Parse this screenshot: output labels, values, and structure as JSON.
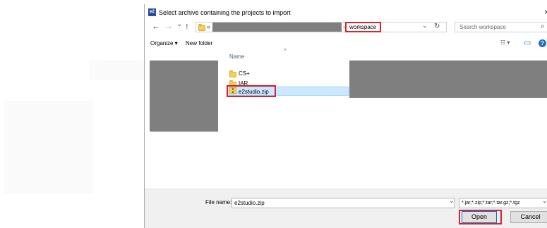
{
  "dialog": {
    "title": "Select archive containing the projects to import",
    "app_icon_text": "e2",
    "close_glyph": "×"
  },
  "nav": {
    "back_glyph": "←",
    "forward_glyph": "→",
    "recent_glyph": "⌄",
    "up_glyph": "↑",
    "overflow": "«",
    "path_sep": "›",
    "current_folder": "workspace",
    "dropdown_glyph": "⌄",
    "refresh_glyph": "↻",
    "search_placeholder": "Search workspace",
    "search_glyph": "⌕"
  },
  "toolbar": {
    "organize_label": "Organize ▾",
    "new_folder_label": "New folder",
    "view_glyph": "☷ ▾",
    "pane_glyph": "▭",
    "help_glyph": "?"
  },
  "file_list": {
    "column_name": "Name",
    "sort_glyph": "^",
    "items": [
      {
        "name": "CS+",
        "type": "folder"
      },
      {
        "name": "IAR",
        "type": "folder"
      },
      {
        "name": "e2studio.zip",
        "type": "zip"
      }
    ]
  },
  "footer": {
    "file_name_label": "File name:",
    "file_name_value": "e2studio.zip",
    "file_name_dropdown": "⌄",
    "filter_value": "*.jar;*.zip;*.tar;*.tar.gz;*.tgz",
    "filter_dropdown": "⌄",
    "open_label": "Open",
    "cancel_label": "Cancel"
  },
  "colors": {
    "highlight": "#e0202c",
    "redaction": "#7f7f7f",
    "selection": "#cce8ff"
  }
}
